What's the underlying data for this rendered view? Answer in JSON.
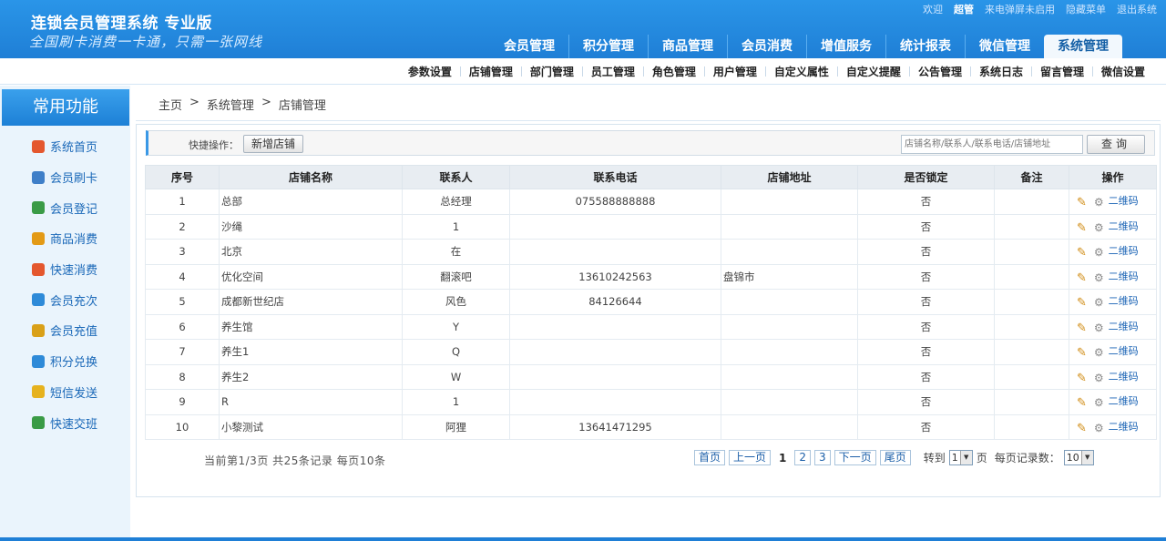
{
  "header": {
    "title": "连锁会员管理系统 专业版",
    "slogan": "全国刷卡消费一卡通，只需一张网线",
    "top_links": {
      "welcome": "欢迎",
      "user": "超管",
      "popup": "来电弹屏未启用",
      "hide_menu": "隐藏菜单",
      "logout": "退出系统"
    },
    "main_nav": [
      {
        "label": "会员管理"
      },
      {
        "label": "积分管理"
      },
      {
        "label": "商品管理"
      },
      {
        "label": "会员消费"
      },
      {
        "label": "增值服务"
      },
      {
        "label": "统计报表"
      },
      {
        "label": "微信管理"
      },
      {
        "label": "系统管理",
        "active": true
      }
    ]
  },
  "sub_nav": [
    {
      "label": "参数设置"
    },
    {
      "label": "店铺管理"
    },
    {
      "label": "部门管理"
    },
    {
      "label": "员工管理"
    },
    {
      "label": "角色管理"
    },
    {
      "label": "用户管理"
    },
    {
      "label": "自定义属性"
    },
    {
      "label": "自定义提醒"
    },
    {
      "label": "公告管理"
    },
    {
      "label": "系统日志"
    },
    {
      "label": "留言管理"
    },
    {
      "label": "微信设置"
    }
  ],
  "sidebar": {
    "title": "常用功能",
    "items": [
      {
        "label": "系统首页",
        "icon": "home-icon",
        "color": "#e4572e"
      },
      {
        "label": "会员刷卡",
        "icon": "member-card-icon",
        "color": "#3f7fc8"
      },
      {
        "label": "会员登记",
        "icon": "register-icon",
        "color": "#3a9b46"
      },
      {
        "label": "商品消费",
        "icon": "cart-icon",
        "color": "#e39a16"
      },
      {
        "label": "快速消费",
        "icon": "quick-consume-icon",
        "color": "#e4572e"
      },
      {
        "label": "会员充次",
        "icon": "recharge-times-icon",
        "color": "#2e8ad8"
      },
      {
        "label": "会员充值",
        "icon": "recharge-icon",
        "color": "#d9a018"
      },
      {
        "label": "积分兑换",
        "icon": "points-exchange-icon",
        "color": "#2e8ad8"
      },
      {
        "label": "短信发送",
        "icon": "sms-icon",
        "color": "#e6b21e"
      },
      {
        "label": "快速交班",
        "icon": "shift-handover-icon",
        "color": "#3a9b46"
      }
    ]
  },
  "breadcrumb": [
    "主页",
    ">",
    "系统管理",
    ">",
    "店铺管理"
  ],
  "quick_ops": {
    "label": "快捷操作：",
    "add_button": "新增店铺",
    "search_placeholder": "店铺名称/联系人/联系电话/店铺地址",
    "search_button": "查询"
  },
  "table": {
    "columns": [
      "序号",
      "店铺名称",
      "联系人",
      "联系电话",
      "店铺地址",
      "是否锁定",
      "备注",
      "操作"
    ],
    "qr_label": "二维码",
    "rows": [
      {
        "no": "1",
        "name": "总部",
        "contact": "总经理",
        "phone": "075588888888",
        "address": "",
        "locked": "否",
        "note": ""
      },
      {
        "no": "2",
        "name": "沙绳",
        "contact": "1",
        "phone": "",
        "address": "",
        "locked": "否",
        "note": ""
      },
      {
        "no": "3",
        "name": "北京",
        "contact": "在",
        "phone": "",
        "address": "",
        "locked": "否",
        "note": ""
      },
      {
        "no": "4",
        "name": "优化空间",
        "contact": "翻滚吧",
        "phone": "13610242563",
        "address": "盘锦市",
        "locked": "否",
        "note": ""
      },
      {
        "no": "5",
        "name": "成都新世纪店",
        "contact": "风色",
        "phone": "84126644",
        "address": "",
        "locked": "否",
        "note": ""
      },
      {
        "no": "6",
        "name": "养生馆",
        "contact": "Y",
        "phone": "",
        "address": "",
        "locked": "否",
        "note": ""
      },
      {
        "no": "7",
        "name": "养生1",
        "contact": "Q",
        "phone": "",
        "address": "",
        "locked": "否",
        "note": ""
      },
      {
        "no": "8",
        "name": "养生2",
        "contact": "W",
        "phone": "",
        "address": "",
        "locked": "否",
        "note": ""
      },
      {
        "no": "9",
        "name": "R",
        "contact": "1",
        "phone": "",
        "address": "",
        "locked": "否",
        "note": ""
      },
      {
        "no": "10",
        "name": "小黎测试",
        "contact": "阿狸",
        "phone": "13641471295",
        "address": "",
        "locked": "否",
        "note": ""
      }
    ]
  },
  "pagination": {
    "info": "当前第1/3页 共25条记录 每页10条",
    "first": "首页",
    "prev": "上一页",
    "current": "1",
    "pages": [
      "2",
      "3"
    ],
    "next": "下一页",
    "last": "尾页",
    "goto_label": "转到",
    "goto_value": "1",
    "page_suffix": "页",
    "per_page_label": "每页记录数：",
    "per_page_value": "10"
  }
}
